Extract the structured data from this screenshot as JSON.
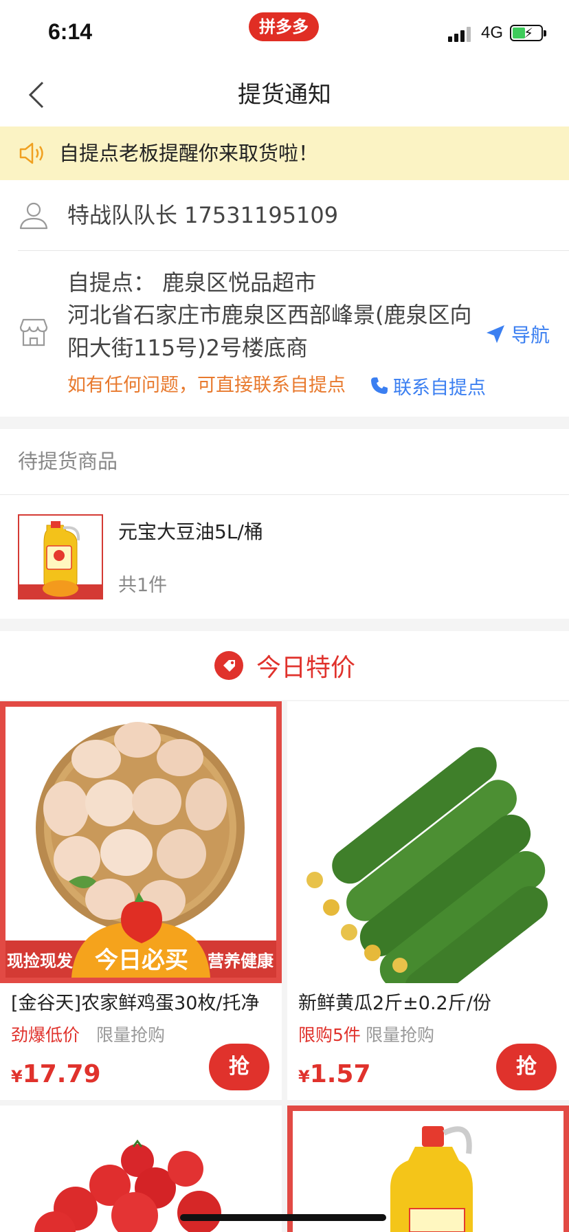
{
  "status_bar": {
    "time": "6:14",
    "app_badge": "拼多多",
    "network": "4G"
  },
  "nav": {
    "title": "提货通知"
  },
  "notice": {
    "text": "自提点老板提醒你来取货啦！"
  },
  "pickup": {
    "contact_person": "特战队队长  17531195109",
    "pickup_point": "自提点：  鹿泉区悦品超市",
    "address": "河北省石家庄市鹿泉区西部峰景(鹿泉区向阳大街115号)2号楼底商",
    "nav_label": "导航",
    "help_text": "如有任何问题，可直接联系自提点",
    "contact_label": "联系自提点"
  },
  "pending": {
    "header": "待提货商品",
    "items": [
      {
        "name": "元宝大豆油5L/桶",
        "count": "共1件"
      }
    ]
  },
  "special": {
    "title": "今日特价"
  },
  "products": [
    {
      "name": "[金谷天]农家鲜鸡蛋30枚/托净",
      "tag1": "劲爆低价",
      "tag2": "限量抢购",
      "currency": "¥",
      "price": "17.79",
      "buy": "抢",
      "banner_left": "现捡现发",
      "banner_center": "今日必买",
      "banner_right": "营养健康"
    },
    {
      "name": "新鲜黄瓜2斤±0.2斤/份",
      "tag1": "限购5件",
      "tag2": "限量抢购",
      "currency": "¥",
      "price": "1.57",
      "buy": "抢"
    }
  ],
  "colors": {
    "brand_red": "#e02e24",
    "link_blue": "#3b7ff1",
    "warn_orange": "#e8792d",
    "notice_bg": "#fbf3c4"
  }
}
